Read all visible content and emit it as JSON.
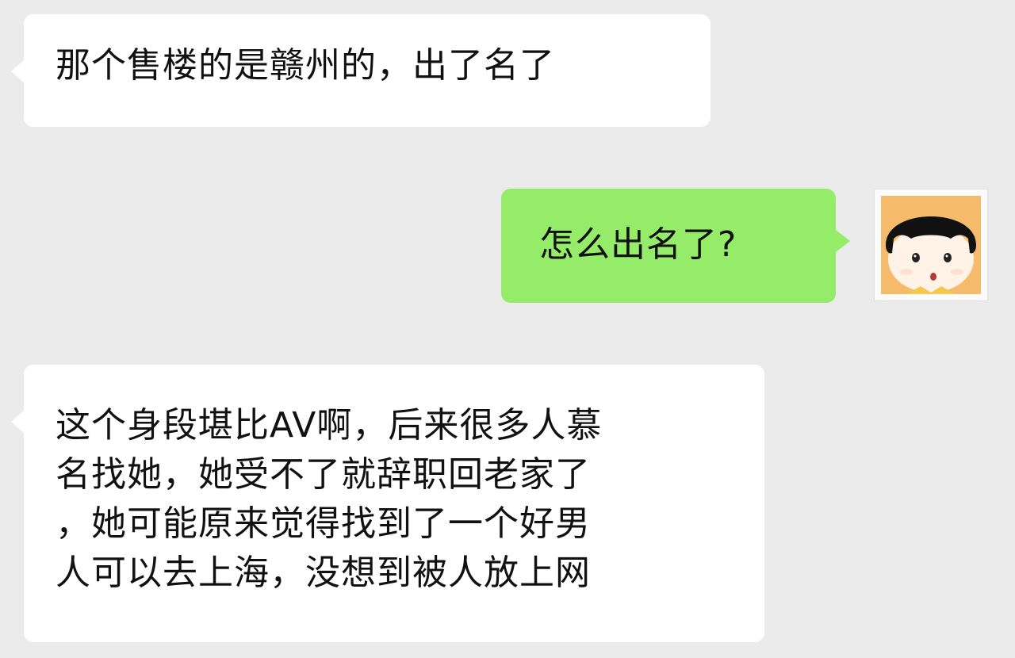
{
  "messages": [
    {
      "id": "msg1",
      "side": "incoming",
      "text": "那个售楼的是赣州的，出了名了"
    },
    {
      "id": "msg2",
      "side": "outgoing",
      "text": "怎么出名了?"
    },
    {
      "id": "msg3",
      "side": "incoming",
      "lines": [
        "这个身段堪比AV啊，后来很多人慕",
        "名找她，她受不了就辞职回老家了",
        "，她可能原来觉得找到了一个好男",
        "人可以去上海，没想到被人放上网"
      ]
    }
  ],
  "avatar": {
    "icon": "cartoon-girl-avatar-icon"
  },
  "colors": {
    "background": "#ebebeb",
    "incoming_bubble": "#ffffff",
    "outgoing_bubble": "#95ec69"
  }
}
